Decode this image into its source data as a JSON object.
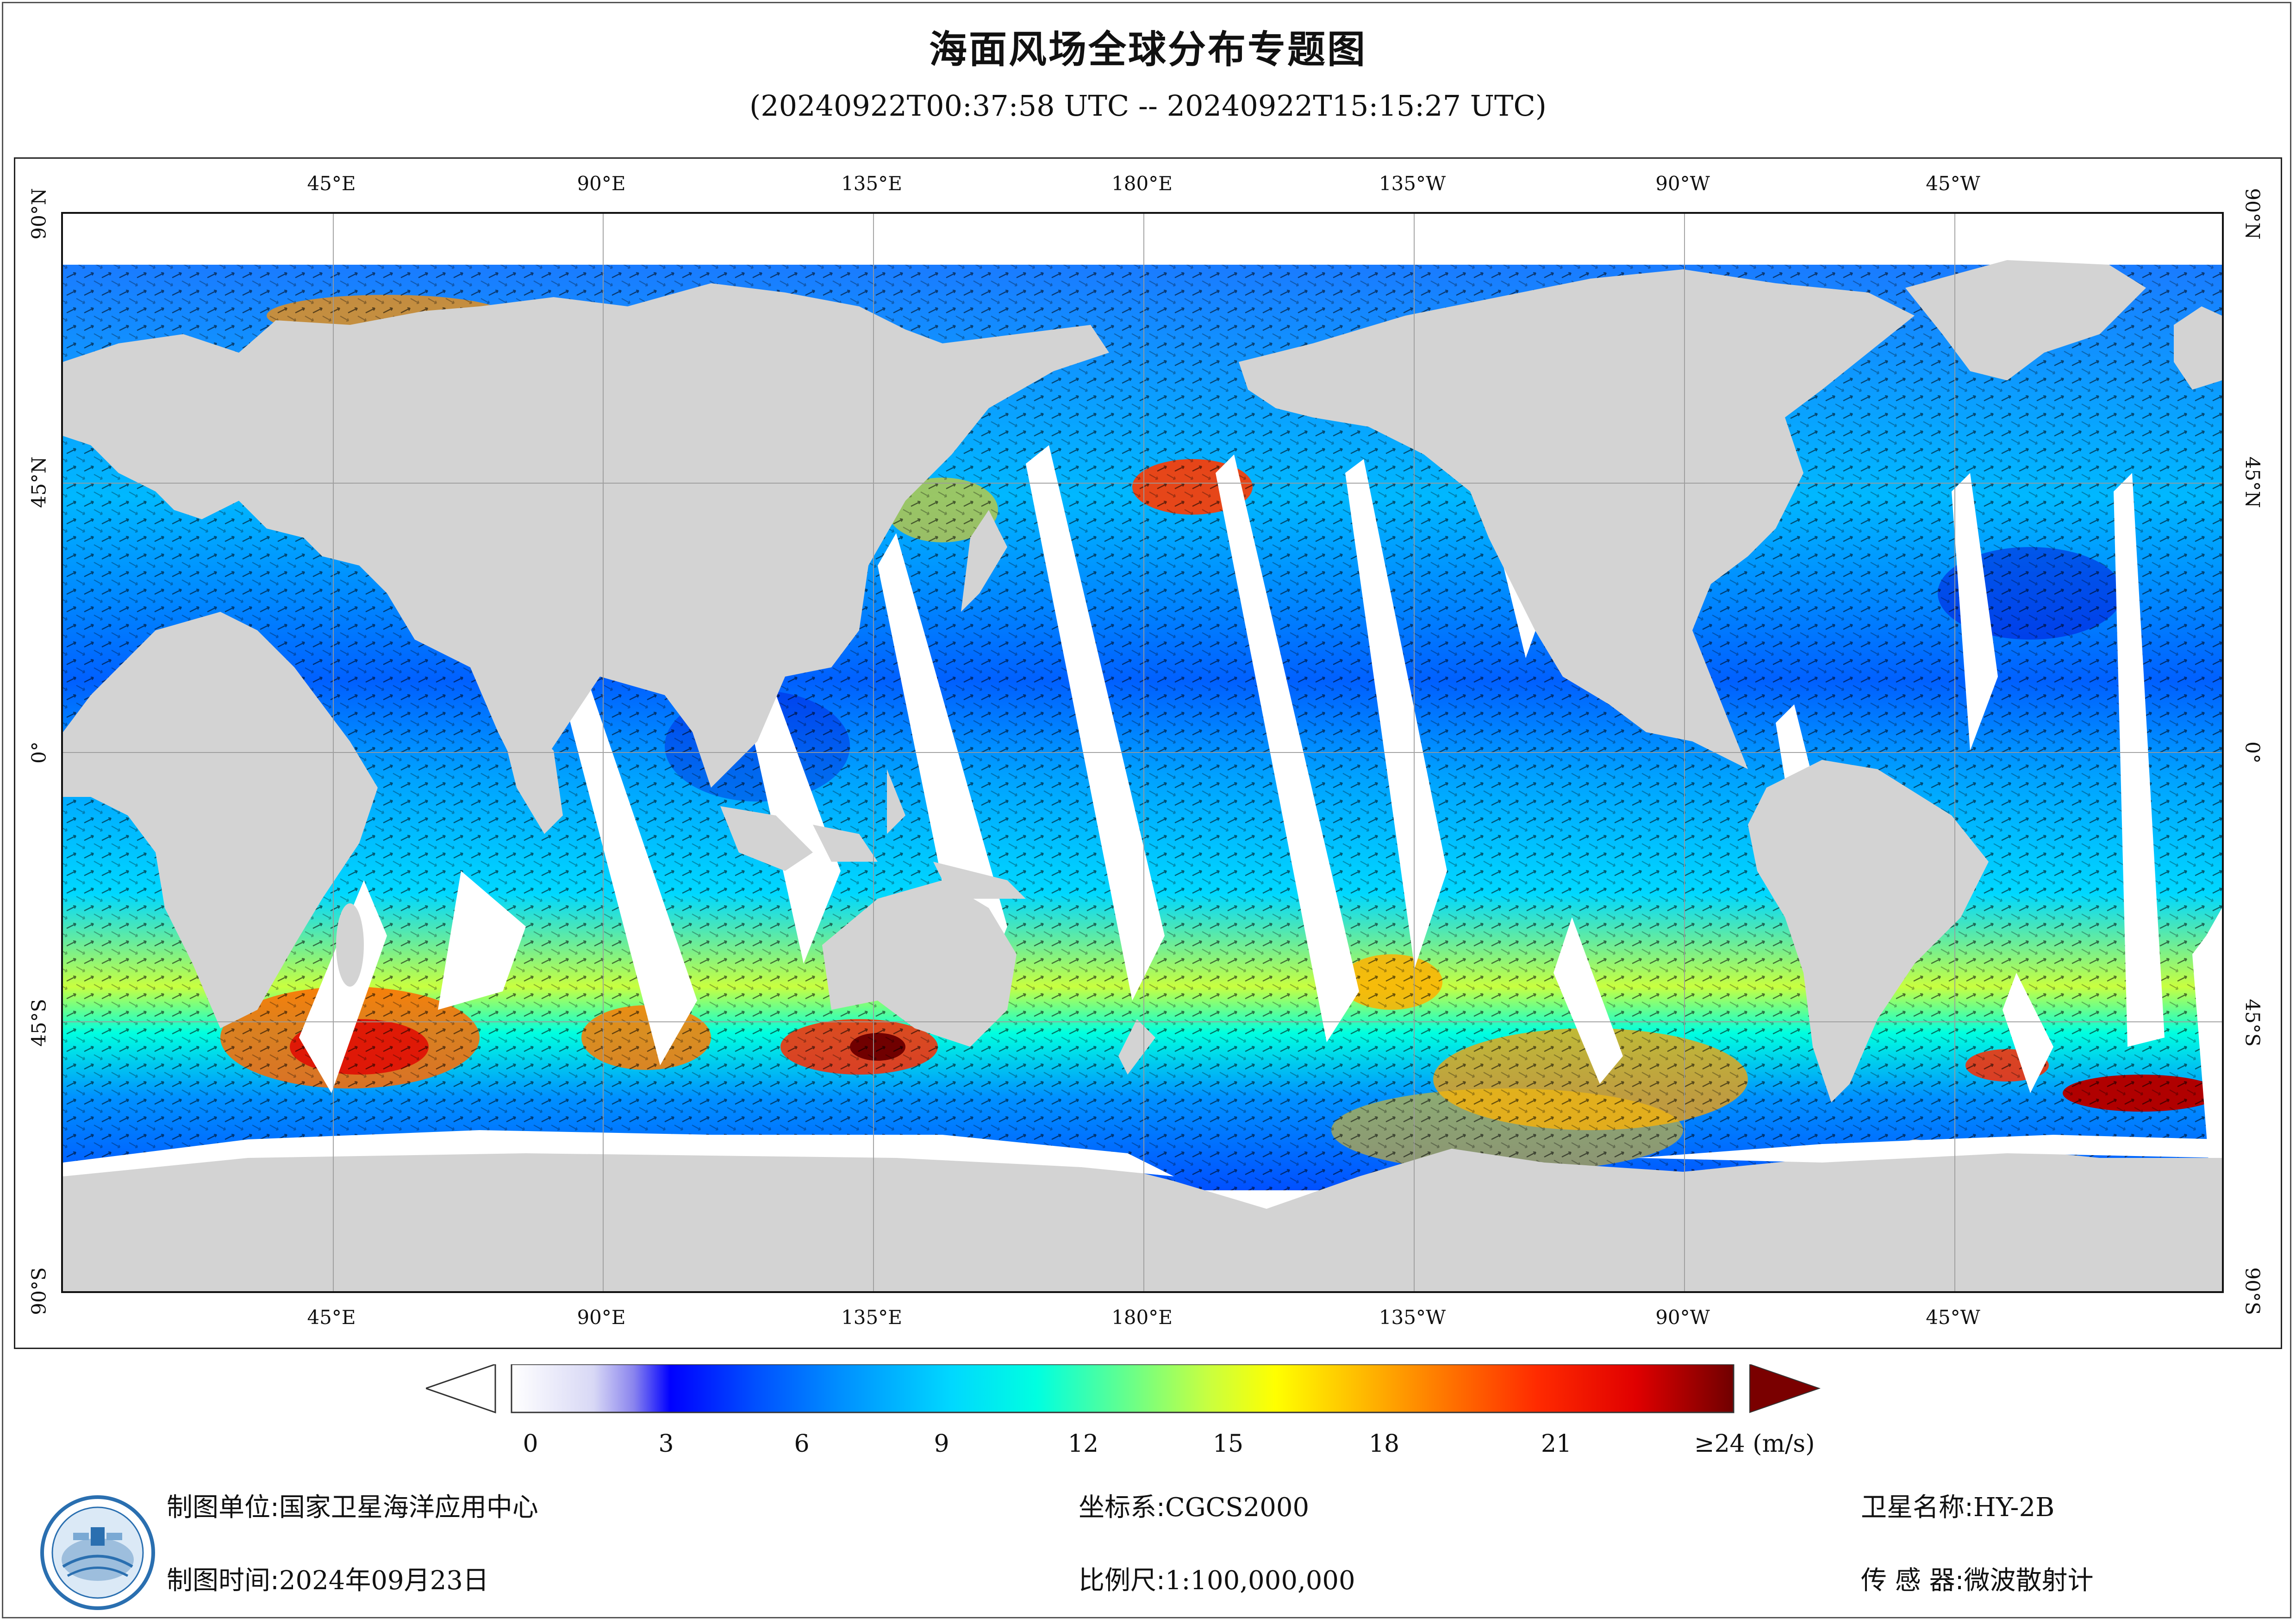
{
  "title": "海面风场全球分布专题图",
  "subtitle": "(20240922T00:37:58 UTC -- 20240922T15:15:27 UTC)",
  "map": {
    "lon_labels": [
      "45°E",
      "90°E",
      "135°E",
      "180°E",
      "135°W",
      "90°W",
      "45°W"
    ],
    "lat_labels": [
      "90°N",
      "45°N",
      "0°",
      "45°S",
      "90°S"
    ],
    "colors": {
      "land": "#d3d3d3",
      "ice": "#ffffff",
      "graticule": "#9a9a9a",
      "swath_gap": "#ffffff",
      "arrow": "#000000"
    }
  },
  "legend": {
    "ticks": [
      "0",
      "3",
      "6",
      "9",
      "12",
      "15",
      "18",
      "21"
    ],
    "max_label": "≥24",
    "unit": "(m/s)",
    "colorscale": [
      "#ffffff",
      "#d8d8f5",
      "#8a84ee",
      "#0000ff",
      "#0050ff",
      "#0090ff",
      "#00d8ff",
      "#00ffe0",
      "#60ff90",
      "#c8ff40",
      "#ffff00",
      "#ffc000",
      "#ff7a00",
      "#ff2a00",
      "#e00000",
      "#700000"
    ],
    "over_color": "#7a0000"
  },
  "footer": {
    "unit_key": "制图单位:",
    "unit_value": "国家卫星海洋应用中心",
    "time_key": "制图时间:",
    "time_value": "2024年09月23日",
    "crs_key": "坐标系:",
    "crs_value": "CGCS2000",
    "scale_key": "比例尺:",
    "scale_value": "1:100,000,000",
    "sat_key": "卫星名称:",
    "sat_value": "HY-2B",
    "sensor_key": "传 感 器:",
    "sensor_value": "微波散射计"
  }
}
